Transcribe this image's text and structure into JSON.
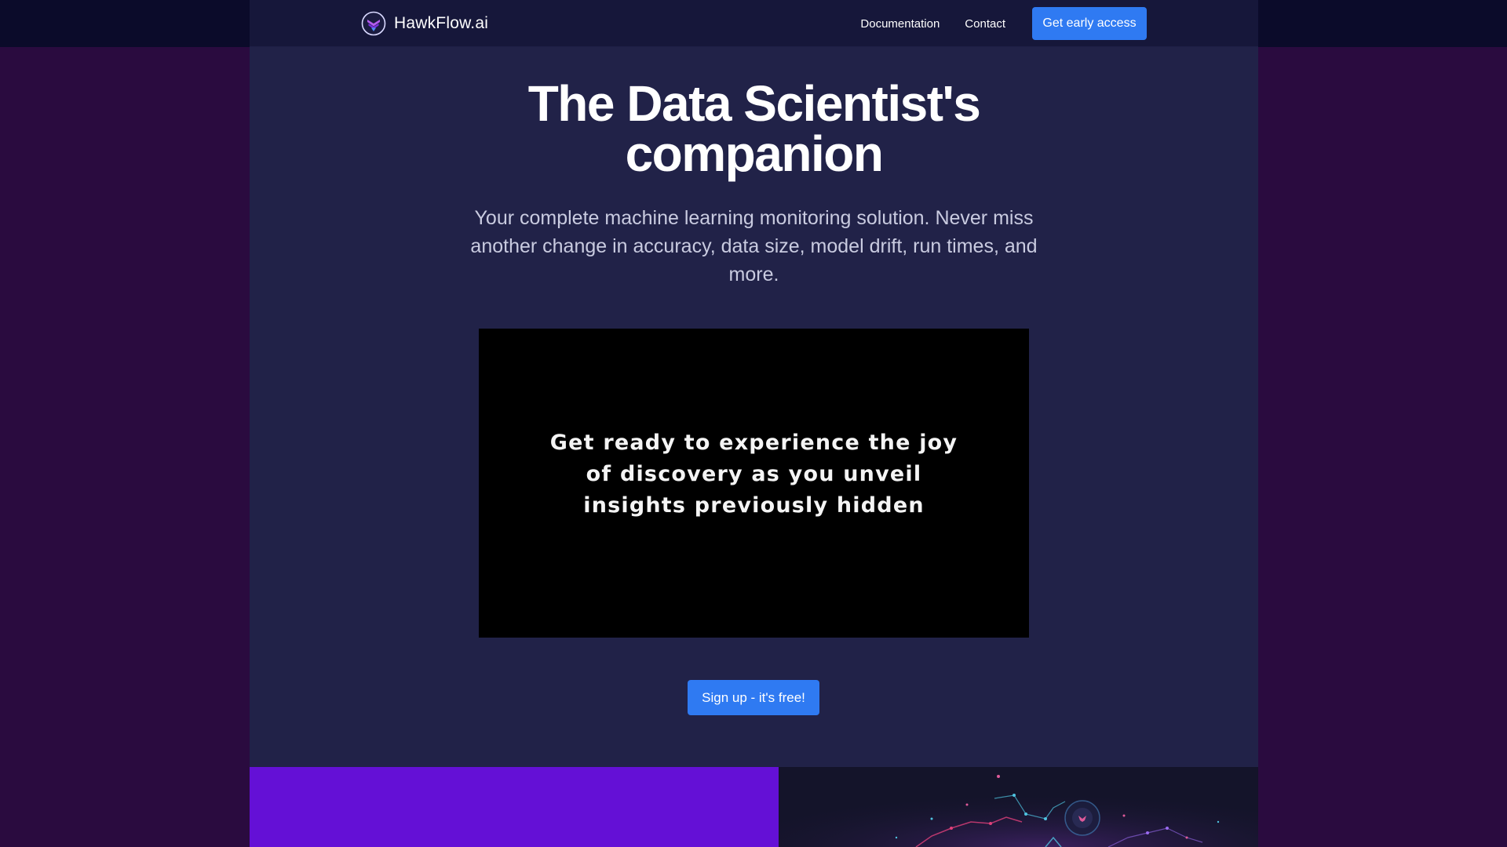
{
  "brand": {
    "name": "HawkFlow.ai",
    "logo_icon": "hawk-shield-logo-icon"
  },
  "nav": {
    "documentation": "Documentation",
    "contact": "Contact",
    "cta": "Get early access"
  },
  "hero": {
    "title_line1": "The Data Scientist's",
    "title_line2": "companion",
    "subtitle": "Your complete machine learning monitoring solution. Never miss another change in accuracy, data size, model drift, run times, and more."
  },
  "video": {
    "caption": "Get ready to experience the joy of discovery as you unveil insights previously hidden"
  },
  "signup": {
    "label": "Sign up - it's free!"
  },
  "colors": {
    "accent": "#2f7af2",
    "page_bg": "#212248",
    "outer_bg": "#2a0b3f",
    "feature_purple": "#6410d6"
  }
}
